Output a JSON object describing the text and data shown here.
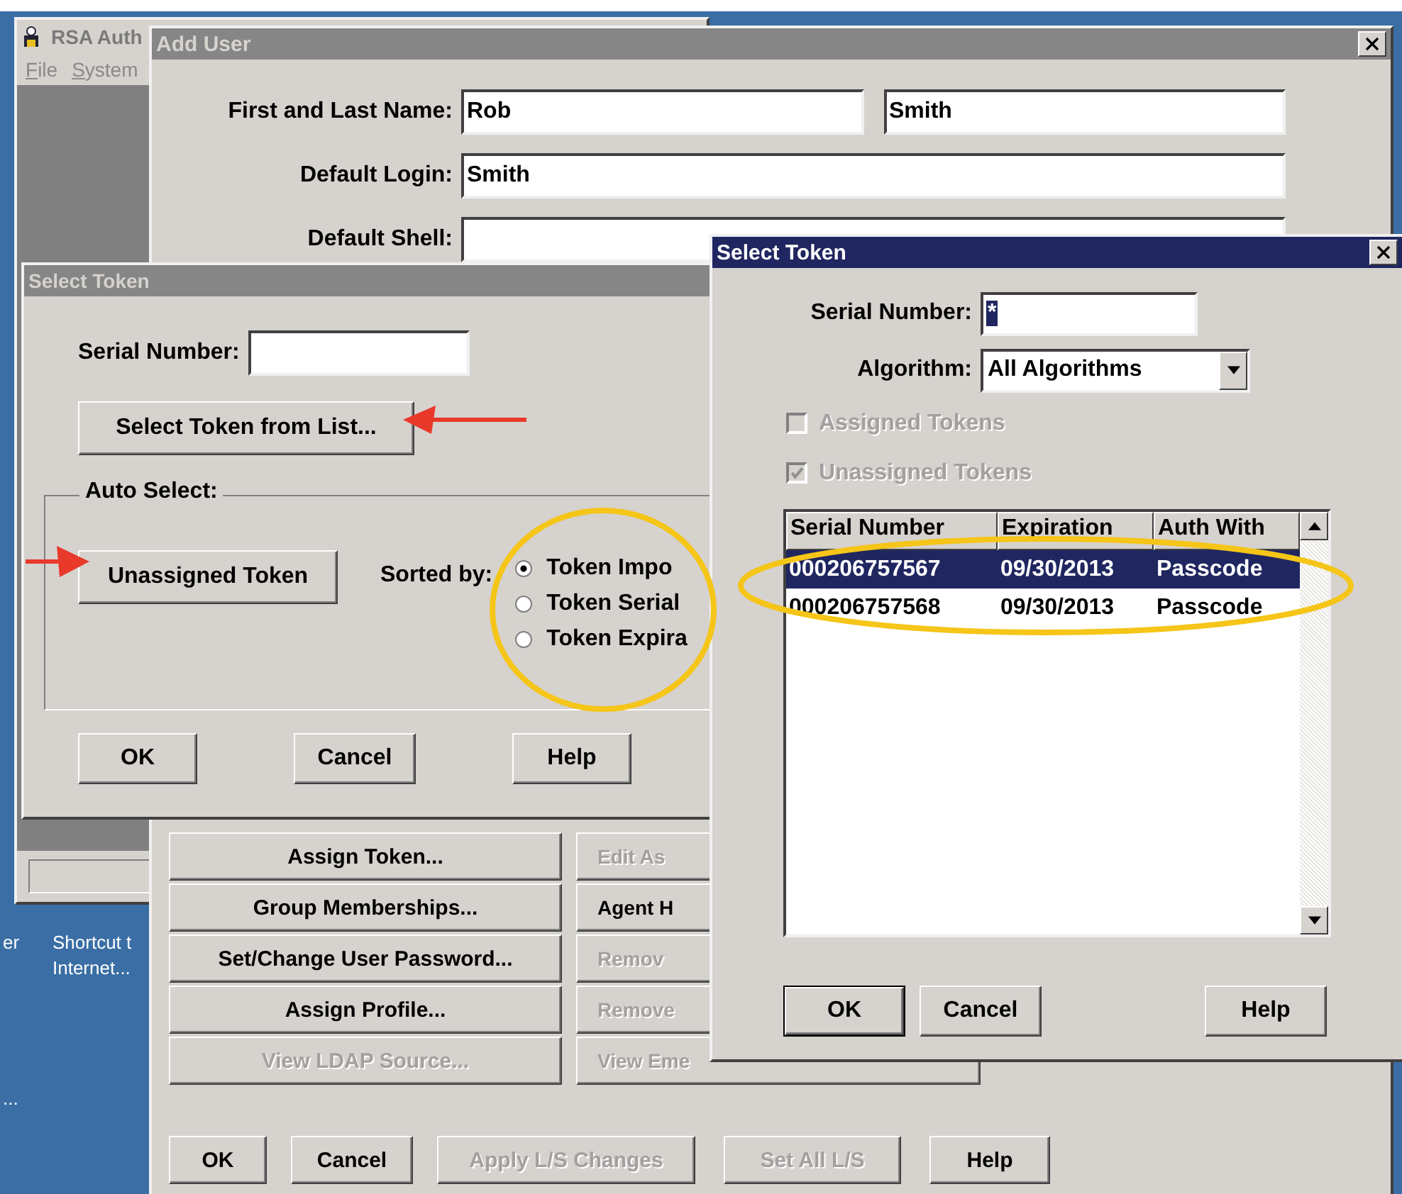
{
  "desktop": {
    "icons": [
      {
        "label": "er"
      },
      {
        "label": "Shortcut t\nInternet..."
      },
      {
        "label": "..."
      }
    ]
  },
  "main_window": {
    "title": "RSA Auth",
    "menu": [
      "File",
      "System"
    ]
  },
  "add_user": {
    "title": "Add User",
    "fields": [
      {
        "label": "First and Last Name:",
        "values": [
          "Rob",
          "Smith"
        ]
      },
      {
        "label": "Default Login:",
        "values": [
          "Smith"
        ]
      },
      {
        "label": "Default Shell:"
      }
    ],
    "left_buttons": [
      {
        "label": "Assign Token...",
        "disabled": false
      },
      {
        "label": "Group Memberships...",
        "disabled": false
      },
      {
        "label": "Set/Change User Password...",
        "disabled": false
      },
      {
        "label": "Assign Profile...",
        "disabled": false
      },
      {
        "label": "View LDAP Source...",
        "disabled": true
      }
    ],
    "right_buttons": [
      {
        "label": "Edit As",
        "disabled": true
      },
      {
        "label": "Agent H",
        "disabled": false
      },
      {
        "label": "Remov",
        "disabled": true
      },
      {
        "label": "Remove",
        "disabled": true
      },
      {
        "label": "View Eme",
        "disabled": true
      }
    ],
    "footer_buttons": [
      {
        "label": "OK",
        "disabled": false
      },
      {
        "label": "Cancel",
        "disabled": false
      },
      {
        "label": "Apply L/S Changes",
        "disabled": true
      },
      {
        "label": "Set All L/S",
        "disabled": true
      },
      {
        "label": "Help",
        "disabled": false
      }
    ]
  },
  "back_dialog": {
    "title": "Select Token",
    "serial_label": "Serial Number:",
    "list_button": "Select Token from List...",
    "group_label": "Auto Select:",
    "auto_button": "Unassigned Token",
    "sorted_label": "Sorted by:",
    "sort_options": [
      {
        "label": "Token Impo",
        "selected": true
      },
      {
        "label": "Token Serial",
        "selected": false
      },
      {
        "label": "Token Expira",
        "selected": false
      }
    ],
    "buttons": [
      "OK",
      "Cancel",
      "Help"
    ]
  },
  "front_dialog": {
    "title": "Select Token",
    "serial_label": "Serial Number:",
    "serial_value": "*",
    "algorithm_label": "Algorithm:",
    "algorithm_value": "All Algorithms",
    "checkboxes": [
      {
        "label": "Assigned Tokens",
        "checked": false,
        "disabled": true
      },
      {
        "label": "Unassigned Tokens",
        "checked": true,
        "disabled": true
      }
    ],
    "columns": [
      "Serial Number",
      "Expiration",
      "Auth With"
    ],
    "rows": [
      {
        "cells": [
          "000206757567",
          "09/30/2013",
          "Passcode"
        ],
        "selected": true
      },
      {
        "cells": [
          "000206757568",
          "09/30/2013",
          "Passcode"
        ],
        "selected": false
      }
    ],
    "buttons": [
      {
        "label": "OK",
        "default": true
      },
      {
        "label": "Cancel",
        "default": false
      },
      {
        "label": "Help",
        "default": false
      }
    ]
  }
}
